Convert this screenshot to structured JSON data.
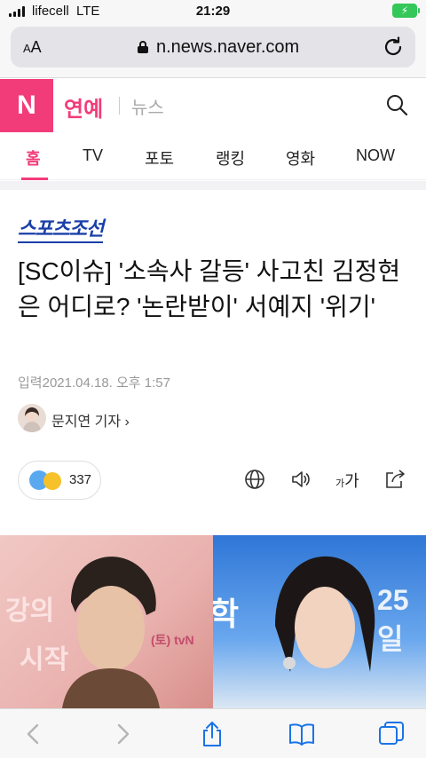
{
  "status": {
    "carrier": "lifecell",
    "network": "LTE",
    "time": "21:29"
  },
  "browser": {
    "aa_small": "A",
    "aa_big": "A",
    "url": "n.news.naver.com"
  },
  "naver": {
    "logo": "N",
    "section": "연예",
    "subsection": "뉴스"
  },
  "tabs": [
    {
      "label": "홈",
      "active": true
    },
    {
      "label": "TV"
    },
    {
      "label": "포토"
    },
    {
      "label": "랭킹"
    },
    {
      "label": "영화"
    },
    {
      "label": "NOW"
    }
  ],
  "article": {
    "press": "스포츠조선",
    "headline": "[SC이슈] '소속사 갈등' 사고친 김정현은 어디로? '논란받이' 서예지 '위기'",
    "date": "입력2021.04.18. 오후 1:57",
    "reporter": "문지연 기자 ›",
    "reaction_count": "337",
    "fontsize_small": "가",
    "fontsize_big": "가"
  },
  "photos": {
    "left_text1": "강의",
    "left_text2": "시작",
    "left_text3": "(토) tvN",
    "right_text1": "학",
    "right_text2": "25일"
  },
  "colors": {
    "accent": "#f23c7a",
    "press": "#1a3fa8",
    "ios_blue": "#1a73e8"
  }
}
